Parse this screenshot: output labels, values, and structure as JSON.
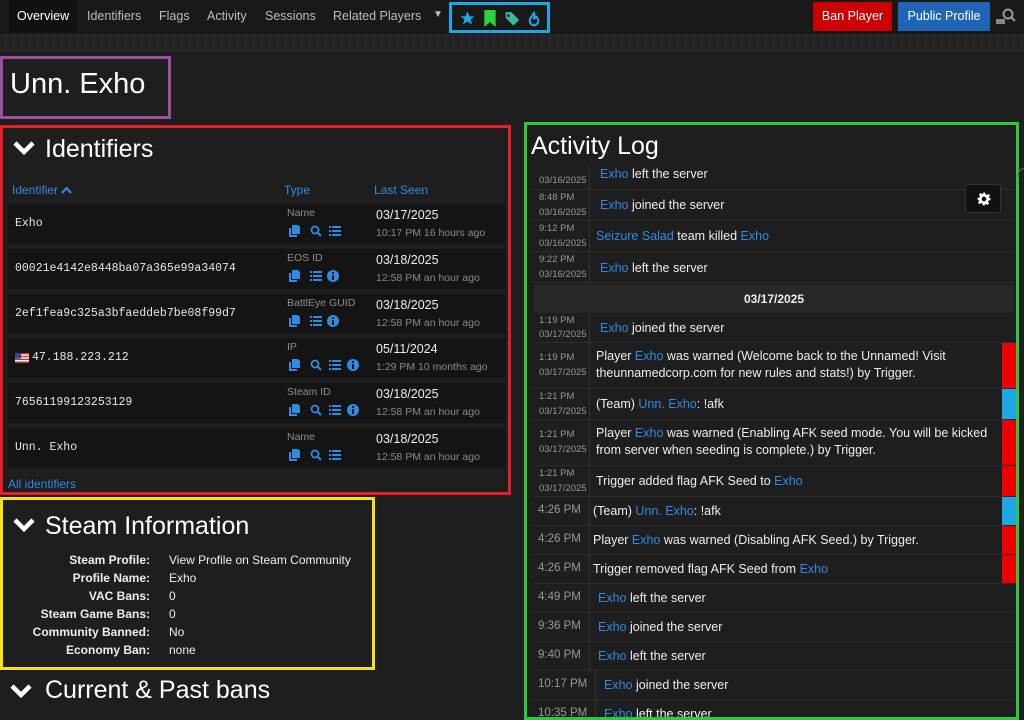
{
  "nav": {
    "tabs": [
      "Overview",
      "Identifiers",
      "Flags",
      "Activity",
      "Sessions",
      "Related Players"
    ],
    "active_tab": "Overview",
    "ban_label": "Ban Player",
    "profile_label": "Public Profile",
    "flag_icons": [
      "star-icon",
      "bookmark-icon",
      "tag-icon",
      "flame-icon"
    ],
    "colors": {
      "ban": "#cc0000",
      "profile": "#1f64b5",
      "accent": "#2f8be6"
    }
  },
  "player": {
    "name": "Unn. Exho"
  },
  "identifiers": {
    "title": "Identifiers",
    "col_identifier": "Identifier",
    "col_type": "Type",
    "col_last_seen": "Last Seen",
    "rows": [
      {
        "value": "Exho",
        "type": "Name",
        "date": "03/17/2025",
        "time": "10:17 PM 16 hours ago"
      },
      {
        "value": "00021e4142e8448ba07a365e99a34074",
        "type": "EOS ID",
        "date": "03/18/2025",
        "time": "12:58 PM an hour ago"
      },
      {
        "value": "2ef1fea9c325a3bfaeddeb7be08f99d7",
        "type": "BattlEye GUID",
        "date": "03/18/2025",
        "time": "12:58 PM an hour ago"
      },
      {
        "value": "47.188.223.212",
        "type": "IP",
        "date": "05/11/2024",
        "time": "1:29 PM 10 months ago"
      },
      {
        "value": "76561199123253129",
        "type": "Steam ID",
        "date": "03/18/2025",
        "time": "12:58 PM an hour ago"
      },
      {
        "value": "Unn. Exho",
        "type": "Name",
        "date": "03/18/2025",
        "time": "12:58 PM an hour ago"
      }
    ],
    "all_link": "All identifiers"
  },
  "steam": {
    "title": "Steam Information",
    "rows": [
      {
        "label": "Steam Profile:",
        "value": "View Profile on Steam Community"
      },
      {
        "label": "Profile Name:",
        "value": "Exho"
      },
      {
        "label": "VAC Bans:",
        "value": "0"
      },
      {
        "label": "Steam Game Bans:",
        "value": "0"
      },
      {
        "label": "Community Banned:",
        "value": "No"
      },
      {
        "label": "Economy Ban:",
        "value": "none"
      }
    ]
  },
  "bans": {
    "title": "Current & Past bans"
  },
  "activity": {
    "title": "Activity Log",
    "date_separator": "03/17/2025",
    "entries": [
      {
        "time": "",
        "date": "03/16/2025",
        "parts": [
          "Exho",
          " left the server"
        ]
      },
      {
        "time": "8:48 PM",
        "date": "03/16/2025",
        "parts": [
          "Exho",
          " joined the server"
        ]
      },
      {
        "time": "9:12 PM",
        "date": "03/16/2025",
        "parts": [
          "Seizure Salad",
          " team killed ",
          "Exho"
        ]
      },
      {
        "time": "9:22 PM",
        "date": "03/16/2025",
        "parts": [
          "Exho",
          " left the server"
        ]
      },
      {
        "time": "1:19 PM",
        "date": "03/17/2025",
        "parts": [
          "Exho",
          " joined the server"
        ]
      },
      {
        "time": "1:19 PM",
        "date": "03/17/2025",
        "parts": [
          "Player ",
          "Exho",
          " was warned (Welcome back to the Unnamed! Visit",
          "theunnamedcorp.com for new rules and stats!) by Trigger."
        ]
      },
      {
        "time": "1:21 PM",
        "date": "03/17/2025",
        "parts": [
          "(Team) ",
          "Unn.  Exho",
          ": !afk"
        ]
      },
      {
        "time": "1:21 PM",
        "date": "03/17/2025",
        "parts": [
          "Player ",
          "Exho",
          " was warned (Enabling AFK seed mode. You will be kicked",
          "from server when seeding is complete.) by Trigger."
        ]
      },
      {
        "time": "1:21 PM",
        "date": "03/17/2025",
        "parts": [
          "Trigger added flag AFK Seed to ",
          "Exho"
        ]
      },
      {
        "time": "4:26 PM",
        "parts": [
          "(Team) ",
          "Unn. Exho",
          ": !afk"
        ]
      },
      {
        "time": "4:26 PM",
        "parts": [
          "Player ",
          "Exho",
          " was warned (Disabling AFK Seed.) by Trigger."
        ]
      },
      {
        "time": "4:26 PM",
        "parts": [
          "Trigger removed flag AFK Seed from ",
          "Exho"
        ]
      },
      {
        "time": "4:49 PM",
        "parts": [
          "Exho",
          " left the server"
        ]
      },
      {
        "time": "9:36 PM",
        "parts": [
          "Exho",
          " joined the server"
        ]
      },
      {
        "time": "9:40 PM",
        "parts": [
          "Exho",
          " left the server"
        ]
      },
      {
        "time": "10:17 PM",
        "parts": [
          "Exho",
          " joined the server"
        ]
      },
      {
        "time": "10:35 PM",
        "parts": [
          "Exho",
          " left the server"
        ]
      }
    ],
    "bar_colors": {
      "warn": "#ee0000",
      "team": "#1ea7e6"
    }
  }
}
